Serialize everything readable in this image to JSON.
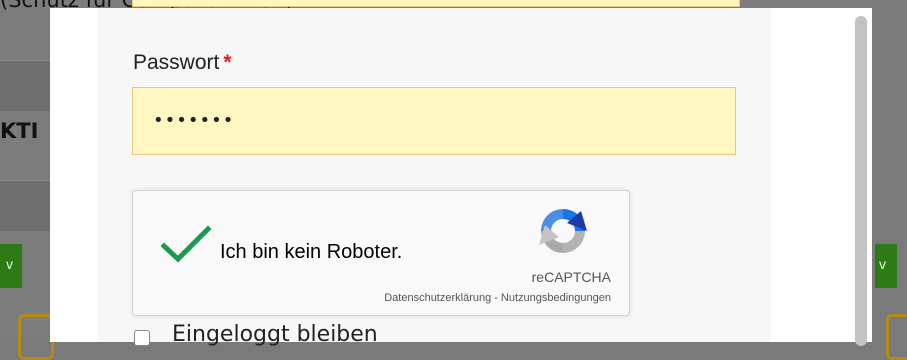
{
  "background": {
    "top_text": "(Schutz für Computer-Viren).",
    "left_text": "KTI",
    "left_badge": "v",
    "right_badge": "v"
  },
  "form": {
    "password_label": "Passwort",
    "required_marker": "*",
    "password_value": "•••••••",
    "stay_logged_in_label": "Eingeloggt bleiben"
  },
  "recaptcha": {
    "label": "Ich bin kein Roboter.",
    "brand": "reCAPTCHA",
    "privacy_link": "Datenschutzerklärung",
    "separator": "-",
    "terms_link": "Nutzungsbedingungen",
    "checked": true,
    "check_color": "#1a9a4a"
  },
  "colors": {
    "input_bg": "#fff7c2",
    "input_border": "#e6c97a",
    "required": "#e02020",
    "overlay": "#7a7a7a"
  }
}
